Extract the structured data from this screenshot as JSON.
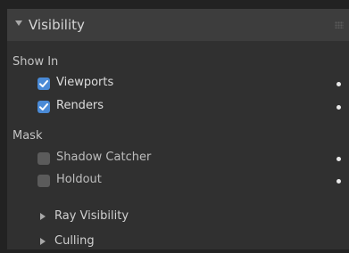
{
  "panel": {
    "title": "Visibility",
    "expanded": true
  },
  "show_in": {
    "label": "Show In",
    "items": [
      {
        "label": "Viewports",
        "checked": true
      },
      {
        "label": "Renders",
        "checked": true
      }
    ]
  },
  "mask": {
    "label": "Mask",
    "items": [
      {
        "label": "Shadow Catcher",
        "checked": false
      },
      {
        "label": "Holdout",
        "checked": false
      }
    ]
  },
  "subpanels": [
    {
      "label": "Ray Visibility",
      "expanded": false
    },
    {
      "label": "Culling",
      "expanded": false
    }
  ],
  "colors": {
    "accent": "#4a8ad6",
    "background": "#303030",
    "header": "#3d3d3d"
  }
}
